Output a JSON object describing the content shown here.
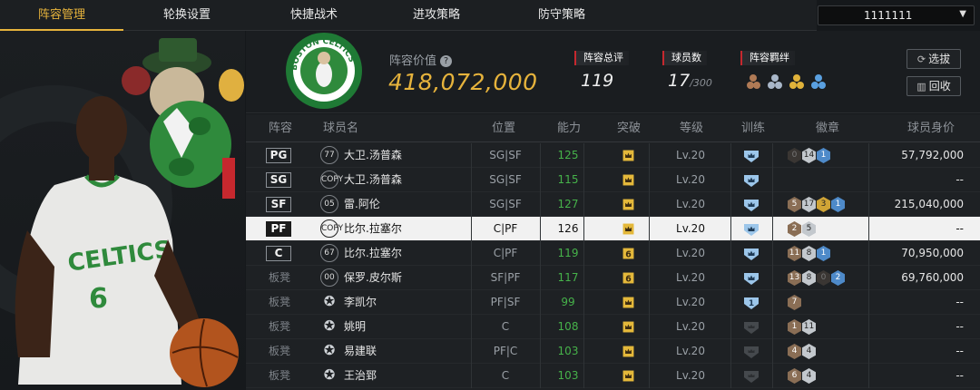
{
  "tabs": [
    {
      "label": "阵容管理",
      "active": true
    },
    {
      "label": "轮换设置"
    },
    {
      "label": "快捷战术"
    },
    {
      "label": "进攻策略"
    },
    {
      "label": "防守策略"
    }
  ],
  "account_select": {
    "value": "1111111"
  },
  "team_logo_text": "BOSTON CELTICS",
  "summary": {
    "lineup_value_label": "阵容价值",
    "lineup_value": "418,072,000",
    "rating_label": "阵容总评",
    "rating": "119",
    "player_count_label": "球员数",
    "player_count": "17",
    "player_count_max": "/300",
    "bond_label": "阵容羁绊",
    "select_btn": "选拔",
    "recycle_btn": "回收"
  },
  "columns": [
    "阵容",
    "球员名",
    "位置",
    "能力",
    "突破",
    "等级",
    "训练",
    "徽章",
    "球员身价"
  ],
  "players": [
    {
      "slot": "PG",
      "jersey": "77",
      "name": "大卫.汤普森",
      "position": "SG|SF",
      "ability": "125",
      "breakthrough": "crown",
      "level": "Lv.20",
      "training": "crown",
      "badges": [
        {
          "t": "dark",
          "v": "0"
        },
        {
          "t": "silver",
          "v": "14"
        },
        {
          "t": "blue",
          "v": "1"
        }
      ],
      "value": "57,792,000"
    },
    {
      "slot": "SG",
      "jersey": "COPY",
      "name": "大卫.汤普森",
      "position": "SG|SF",
      "ability": "115",
      "breakthrough": "crown",
      "level": "Lv.20",
      "training": "crown",
      "badges": [],
      "value": "--"
    },
    {
      "slot": "SF",
      "jersey": "05",
      "name": "雷.阿伦",
      "position": "SG|SF",
      "ability": "127",
      "breakthrough": "crown",
      "level": "Lv.20",
      "training": "crown",
      "badges": [
        {
          "t": "bronze",
          "v": "5"
        },
        {
          "t": "silver",
          "v": "17"
        },
        {
          "t": "gold",
          "v": "3"
        },
        {
          "t": "blue",
          "v": "1"
        }
      ],
      "value": "215,040,000"
    },
    {
      "slot": "PF",
      "jersey": "COPY",
      "name": "比尔.拉塞尔",
      "position": "C|PF",
      "ability": "126",
      "breakthrough": "crown",
      "level": "Lv.20",
      "training": "crown",
      "badges": [
        {
          "t": "bronze",
          "v": "2"
        },
        {
          "t": "silver",
          "v": "5"
        }
      ],
      "value": "--",
      "selected": true
    },
    {
      "slot": "C",
      "jersey": "67",
      "name": "比尔.拉塞尔",
      "position": "C|PF",
      "ability": "119",
      "breakthrough": "6",
      "level": "Lv.20",
      "training": "crown",
      "badges": [
        {
          "t": "bronze",
          "v": "11"
        },
        {
          "t": "silver",
          "v": "8"
        },
        {
          "t": "blue",
          "v": "1"
        }
      ],
      "value": "70,950,000"
    },
    {
      "slot": "板凳",
      "jersey": "00",
      "name": "保罗.皮尔斯",
      "position": "SF|PF",
      "ability": "117",
      "breakthrough": "6",
      "level": "Lv.20",
      "training": "crown",
      "badges": [
        {
          "t": "bronze",
          "v": "13"
        },
        {
          "t": "silver",
          "v": "8"
        },
        {
          "t": "dark",
          "v": "0"
        },
        {
          "t": "blue",
          "v": "2"
        }
      ],
      "value": "69,760,000"
    },
    {
      "slot": "板凳",
      "jersey": "star",
      "name": "李凯尔",
      "position": "PF|SF",
      "ability": "99",
      "breakthrough": "crown",
      "level": "Lv.20",
      "training": "1",
      "badges": [
        {
          "t": "bronze",
          "v": "7"
        }
      ],
      "value": "--"
    },
    {
      "slot": "板凳",
      "jersey": "star",
      "name": "姚明",
      "position": "C",
      "ability": "108",
      "breakthrough": "crown",
      "level": "Lv.20",
      "training": "gray",
      "badges": [
        {
          "t": "bronze",
          "v": "1"
        },
        {
          "t": "silver",
          "v": "11"
        }
      ],
      "value": "--"
    },
    {
      "slot": "板凳",
      "jersey": "star",
      "name": "易建联",
      "position": "PF|C",
      "ability": "103",
      "breakthrough": "crown",
      "level": "Lv.20",
      "training": "gray",
      "badges": [
        {
          "t": "bronze",
          "v": "4"
        },
        {
          "t": "silver",
          "v": "4"
        }
      ],
      "value": "--"
    },
    {
      "slot": "板凳",
      "jersey": "star",
      "name": "王治郅",
      "position": "C",
      "ability": "103",
      "breakthrough": "crown",
      "level": "Lv.20",
      "training": "gray",
      "badges": [
        {
          "t": "bronze",
          "v": "6"
        },
        {
          "t": "silver",
          "v": "4"
        }
      ],
      "value": "--"
    }
  ],
  "colors": {
    "accent": "#e6b33c",
    "ability_green": "#46b24a",
    "celtics_green": "#2f8a3c",
    "selected_row": "#f1f1f1",
    "header_red": "#c6282e"
  }
}
